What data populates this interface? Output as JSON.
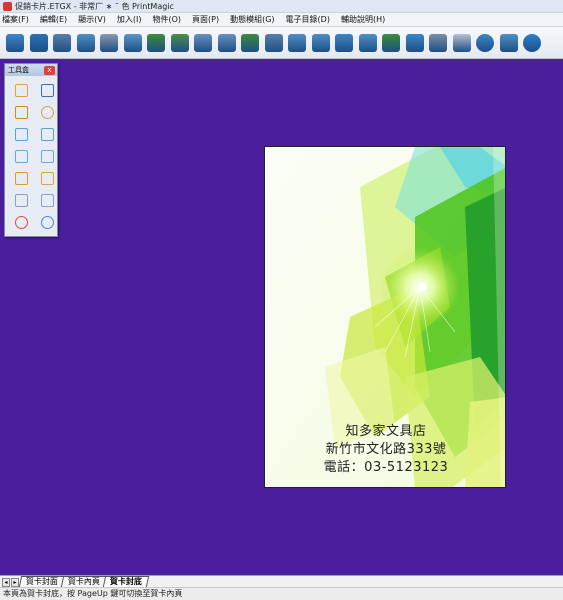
{
  "window": {
    "title": "促銷卡片.ETGX - 非常厂 ∗ ˜ 色 PrintMagic"
  },
  "menu": [
    "檔案(F)",
    "編輯(E)",
    "顯示(V)",
    "加入(I)",
    "物件(O)",
    "頁面(P)",
    "動態模組(G)",
    "電子目錄(D)",
    "輔助說明(H)"
  ],
  "toolbar": {
    "buttons": [
      {
        "icon": "home-icon",
        "color": "#3f86c9"
      },
      {
        "icon": "save-icon",
        "color": "#2d6fb3"
      },
      {
        "icon": "print-icon",
        "color": "#5a7ea8"
      },
      {
        "icon": "print-preview-icon",
        "color": "#4f8fc4"
      },
      {
        "icon": "trash-icon",
        "color": "#8a99ad"
      },
      {
        "icon": "export-image-icon",
        "color": "#5b97c8"
      },
      {
        "icon": "page-forward-icon",
        "color": "#3c8d3c"
      },
      {
        "icon": "page-back-icon",
        "color": "#4a8f4a"
      },
      {
        "icon": "undo-icon",
        "color": "#6a8fbf"
      },
      {
        "icon": "redo-icon",
        "color": "#6a8fbf"
      },
      {
        "icon": "refresh-icon",
        "color": "#3c8d3c"
      },
      {
        "icon": "zoom-icon",
        "color": "#5a7ea8"
      },
      {
        "icon": "edit-text-icon",
        "color": "#4f8fc4"
      },
      {
        "icon": "insert-image-icon",
        "color": "#4f8fc4"
      },
      {
        "icon": "chart-icon",
        "color": "#3b87c6"
      },
      {
        "icon": "gallery-icon",
        "color": "#4f8fc4"
      },
      {
        "icon": "download-image-icon",
        "color": "#3c8d3c"
      },
      {
        "icon": "folder-icon",
        "color": "#3b87c6"
      },
      {
        "icon": "user-icon",
        "color": "#7d8ea6"
      },
      {
        "icon": "calendar-icon",
        "color": "#b8c2d2"
      },
      {
        "icon": "help-icon",
        "color": "#3b87c6"
      },
      {
        "icon": "broadcast-icon",
        "color": "#4f8fc4"
      },
      {
        "icon": "play-icon",
        "color": "#2f7fd0"
      }
    ]
  },
  "toolbox": {
    "title": "工具盒",
    "close_label": "x",
    "tools": [
      {
        "icon": "new-page-icon"
      },
      {
        "icon": "wand-icon"
      },
      {
        "icon": "line-icon"
      },
      {
        "icon": "ellipse-icon"
      },
      {
        "icon": "rotate-left-icon"
      },
      {
        "icon": "rotate-right-icon"
      },
      {
        "icon": "flip-horizontal-icon"
      },
      {
        "icon": "flip-vertical-icon"
      },
      {
        "icon": "copy-icon"
      },
      {
        "icon": "group-icon"
      },
      {
        "icon": "align-icon"
      },
      {
        "icon": "distribute-icon"
      },
      {
        "icon": "merge-icon"
      },
      {
        "icon": "split-icon"
      }
    ]
  },
  "card": {
    "lines": [
      "知多家文具店",
      "新竹市文化路333號",
      "電話：03-5123123"
    ],
    "colors": {
      "green": "#4fc41a",
      "lime": "#c7e83a",
      "cyan": "#7fe3d8",
      "deep": "#1f9a2a"
    }
  },
  "tabs": {
    "nav_prev": "◂",
    "nav_next": "▸",
    "items": [
      {
        "label": "賀卡封面",
        "active": false
      },
      {
        "label": "賀卡內頁",
        "active": false
      },
      {
        "label": "賀卡封底",
        "active": true
      }
    ]
  },
  "status": {
    "text": "本頁為賀卡封底，按 PageUp 鍵可切換至賀卡內頁"
  },
  "workspace_color": "#4a1e9c"
}
